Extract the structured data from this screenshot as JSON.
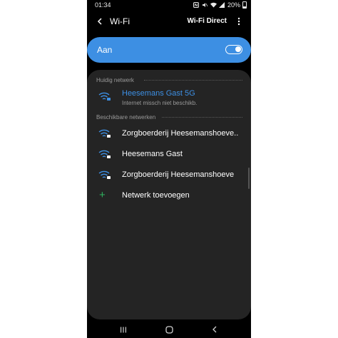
{
  "status_bar": {
    "time": "01:34",
    "battery": "20%"
  },
  "header": {
    "title": "Wi-Fi",
    "wifi_direct": "Wi-Fi Direct"
  },
  "master_toggle": {
    "label": "Aan",
    "state": "on"
  },
  "current_network": {
    "section_label": "Huidig netwerk",
    "name": "Heesemans Gast 5G",
    "status": "Internet missch niet beschikb."
  },
  "available_networks": {
    "section_label": "Beschikbare netwerken",
    "items": [
      {
        "name": "Zorgboerderij Heesemanshoeve.."
      },
      {
        "name": "Heesemans Gast"
      },
      {
        "name": "Zorgboerderij Heesemanshoeve"
      }
    ],
    "add_label": "Netwerk toevoegen"
  },
  "colors": {
    "accent": "#3d8fe3",
    "add": "#2fb35f",
    "card": "#242424",
    "background": "#000000"
  },
  "icons": [
    "back-icon",
    "more-icon",
    "wifi-lock-icon",
    "plus-icon",
    "recents-icon",
    "home-icon",
    "nav-back-icon"
  ]
}
